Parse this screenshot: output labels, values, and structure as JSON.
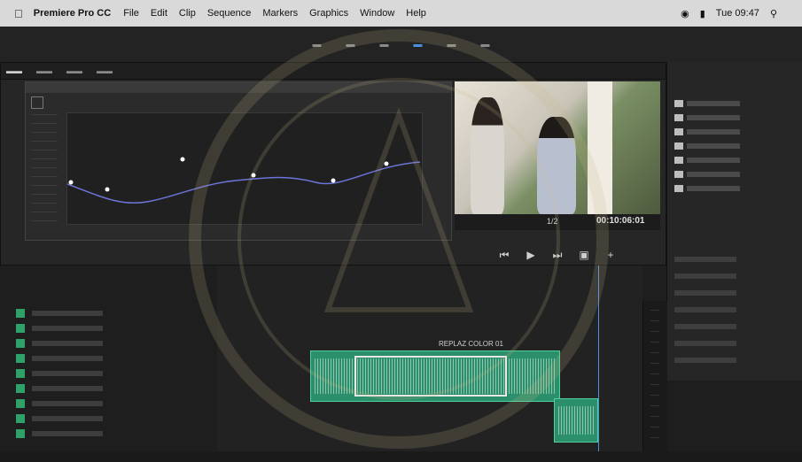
{
  "menubar": {
    "app_name": "Premiere Pro CC",
    "menus": [
      "File",
      "Edit",
      "Clip",
      "Sequence",
      "Markers",
      "Graphics",
      "Window",
      "Help"
    ],
    "clock": "Tue 09:47"
  },
  "program_monitor": {
    "zoom": "1/2",
    "timecode": "00:10:06:01"
  },
  "timeline": {
    "sequence_name": "REPLAZ COLOR 01"
  },
  "theme": {
    "accent": "#4a8fe0",
    "clip_green": "#2b8f6b"
  }
}
